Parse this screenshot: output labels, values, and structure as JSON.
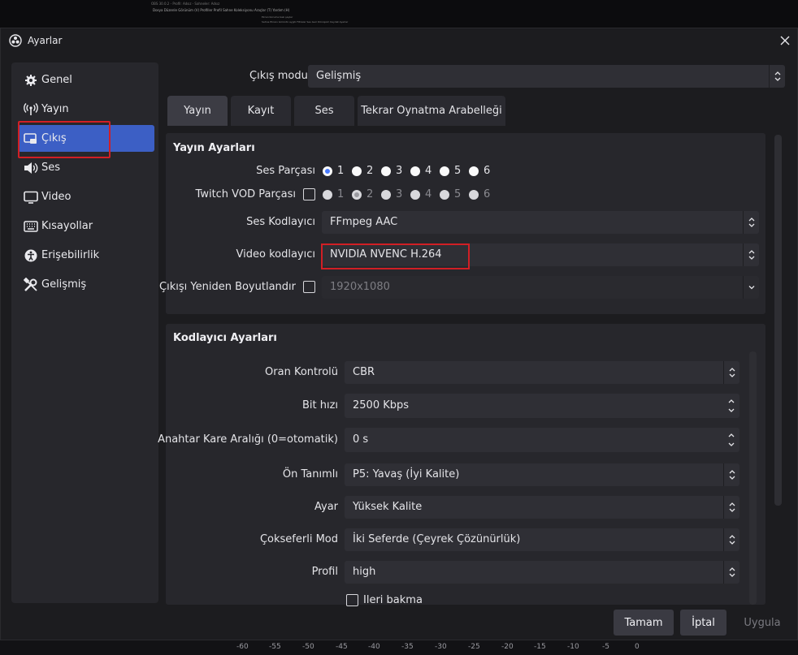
{
  "background": {
    "title_line": "OBS 30.0.2 - Profil: Adsız - Sahneler: Adsız",
    "menu_line": "Dosya   Düzenle   Görünüm (V)   Profiller   Profil   Sahne Koleksiyonu   Araçlar (T)   Yardım (H)",
    "sub_line1": "Ekran Koruma  bazı şeyler",
    "sub_line2": "Sahne   Ekranı   Görüntü aygıtı   Filtreler   Ses   Geri Dönüşüm   Kaydet   Ayarlar",
    "ruler_ticks": [
      "-60",
      "-55",
      "-50",
      "-45",
      "-40",
      "-35",
      "-30",
      "-25",
      "-20",
      "-15",
      "-10",
      "-5",
      "0"
    ]
  },
  "dialog": {
    "title": "Ayarlar"
  },
  "sidebar": {
    "items": [
      {
        "label": "Genel",
        "icon": "gear-icon"
      },
      {
        "label": "Yayın",
        "icon": "antenna-icon"
      },
      {
        "label": "Çıkış",
        "icon": "output-icon",
        "active": true
      },
      {
        "label": "Ses",
        "icon": "speaker-icon"
      },
      {
        "label": "Video",
        "icon": "monitor-icon"
      },
      {
        "label": "Kısayollar",
        "icon": "keyboard-icon"
      },
      {
        "label": "Erişebilirlik",
        "icon": "accessibility-icon"
      },
      {
        "label": "Gelişmiş",
        "icon": "wrench-icon"
      }
    ]
  },
  "output_mode": {
    "label": "Çıkış modu",
    "value": "Gelişmiş"
  },
  "tabs": [
    "Yayın",
    "Kayıt",
    "Ses",
    "Tekrar Oynatma Arabelleği"
  ],
  "stream_settings": {
    "title": "Yayın Ayarları",
    "audio_track_label": "Ses Parçası",
    "audio_tracks": [
      "1",
      "2",
      "3",
      "4",
      "5",
      "6"
    ],
    "twitch_vod_label": "Twitch VOD Parçası",
    "twitch_tracks": [
      "1",
      "2",
      "3",
      "4",
      "5",
      "6"
    ],
    "audio_encoder_label": "Ses Kodlayıcı",
    "audio_encoder_value": "FFmpeg AAC",
    "video_encoder_label": "Video kodlayıcı",
    "video_encoder_value": "NVIDIA NVENC H.264",
    "rescale_label": "Çıkışı Yeniden Boyutlandır",
    "rescale_value": "1920x1080"
  },
  "encoder_settings": {
    "title": "Kodlayıcı Ayarları",
    "rate_control_label": "Oran Kontrolü",
    "rate_control_value": "CBR",
    "bitrate_label": "Bit hızı",
    "bitrate_value": "2500 Kbps",
    "keyframe_label": "Anahtar Kare Aralığı (0=otomatik)",
    "keyframe_value": "0 s",
    "preset_label": "Ön Tanımlı",
    "preset_value": "P5: Yavaş (İyi Kalite)",
    "tuning_label": "Ayar",
    "tuning_value": "Yüksek Kalite",
    "multipass_label": "Çokseferli Mod",
    "multipass_value": "İki Seferde (Çeyrek Çözünürlük)",
    "profile_label": "Profil",
    "profile_value": "high",
    "lookahead_label": "İleri bakma"
  },
  "buttons": {
    "ok": "Tamam",
    "cancel": "İptal",
    "apply": "Uygula"
  },
  "colors": {
    "accent": "#3c5fc5",
    "highlight": "#d11f25",
    "radio_checked": "#4a7cff"
  }
}
